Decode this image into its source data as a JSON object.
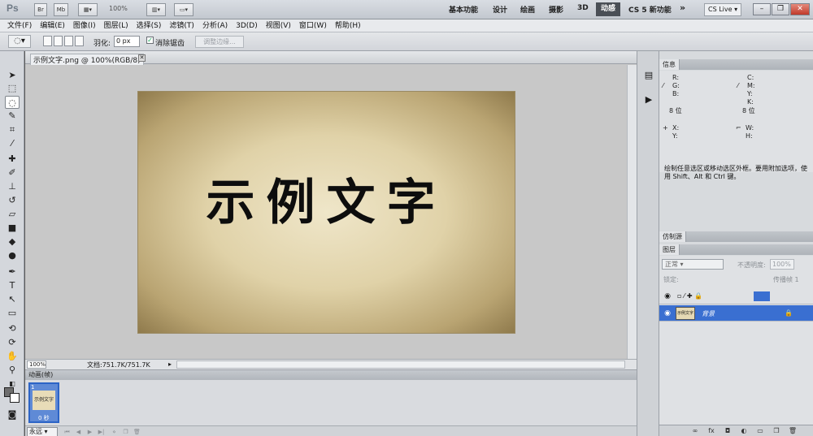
{
  "appbar": {
    "logo": "Ps",
    "br_label": "Br",
    "mb_label": "Mb",
    "zoom": "100%",
    "workspaces": [
      "基本功能",
      "设计",
      "绘画",
      "摄影",
      "3D"
    ],
    "active_workspace": "动感",
    "cs5_new": "CS 5 新功能",
    "more": "»",
    "cslive": "CS Live"
  },
  "menu": [
    "文件(F)",
    "编辑(E)",
    "图像(I)",
    "图层(L)",
    "选择(S)",
    "滤镜(T)",
    "分析(A)",
    "3D(D)",
    "视图(V)",
    "窗口(W)",
    "帮助(H)"
  ],
  "options": {
    "feather_label": "羽化:",
    "feather_value": "0 px",
    "antialias_label": "消除锯齿",
    "refine_edge": "调整边缘..."
  },
  "document": {
    "tab_title": "示例文字.png @ 100%(RGB/8)",
    "canvas_text": "示例文字",
    "zoom": "100%",
    "doc_info": "文档:751.7K/751.7K"
  },
  "animation": {
    "header": "动画(帧)",
    "frame_number": "1",
    "frame_thumb_text": "示例文字",
    "frame_time": "0 秒",
    "loop": "永远"
  },
  "info_panel": {
    "tab": "信息",
    "r": "R:",
    "g": "G:",
    "b": "B:",
    "c": "C:",
    "m": "M:",
    "y": "Y:",
    "k": "K:",
    "bits_left": "8 位",
    "bits_right": "8 位",
    "x": "X:",
    "y2": "Y:",
    "w": "W:",
    "h": "H:",
    "description": "绘制任意选区或移动选区外框。要用附加选项，使用 Shift、Alt 和 Ctrl 键。"
  },
  "clone_panel": {
    "tab": "仿制源"
  },
  "layers_panel": {
    "tab": "图层",
    "blend_mode": "正常",
    "opacity_label": "不透明度:",
    "opacity_value": "100%",
    "lock_label": "锁定:",
    "fill_label": "传播帧 1",
    "layers": [
      {
        "name": "",
        "selected": false
      },
      {
        "name": "背景",
        "selected": true
      }
    ]
  },
  "colors": {
    "accent": "#3a6fd1",
    "frame_border": "#2c64c6"
  }
}
